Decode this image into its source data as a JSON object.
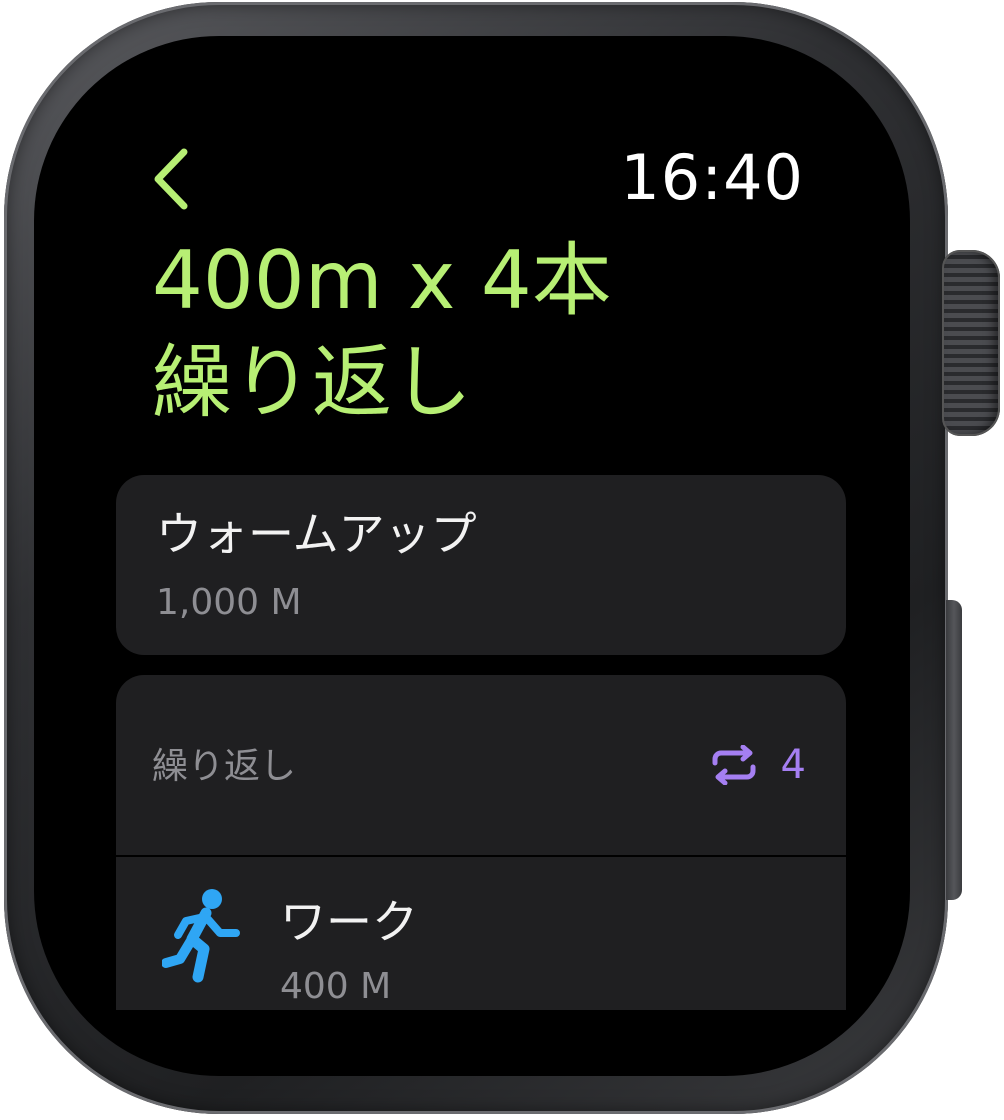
{
  "status": {
    "time": "16:40"
  },
  "workout": {
    "title_line1": "400m x 4本",
    "title_line2": "繰り返し"
  },
  "warmup": {
    "label": "ウォームアップ",
    "distance": "1,000 M"
  },
  "repeat_block": {
    "label": "繰り返し",
    "count": "4",
    "icon": "repeat-icon"
  },
  "work": {
    "label": "ワーク",
    "distance": "400 M",
    "icon": "running-figure-icon"
  },
  "colors": {
    "accent_green": "#b7ef74",
    "accent_purple": "#a57ff2",
    "accent_blue": "#2fa6f4",
    "card_background": "#1f1f21",
    "secondary_text": "#8e8e93"
  }
}
